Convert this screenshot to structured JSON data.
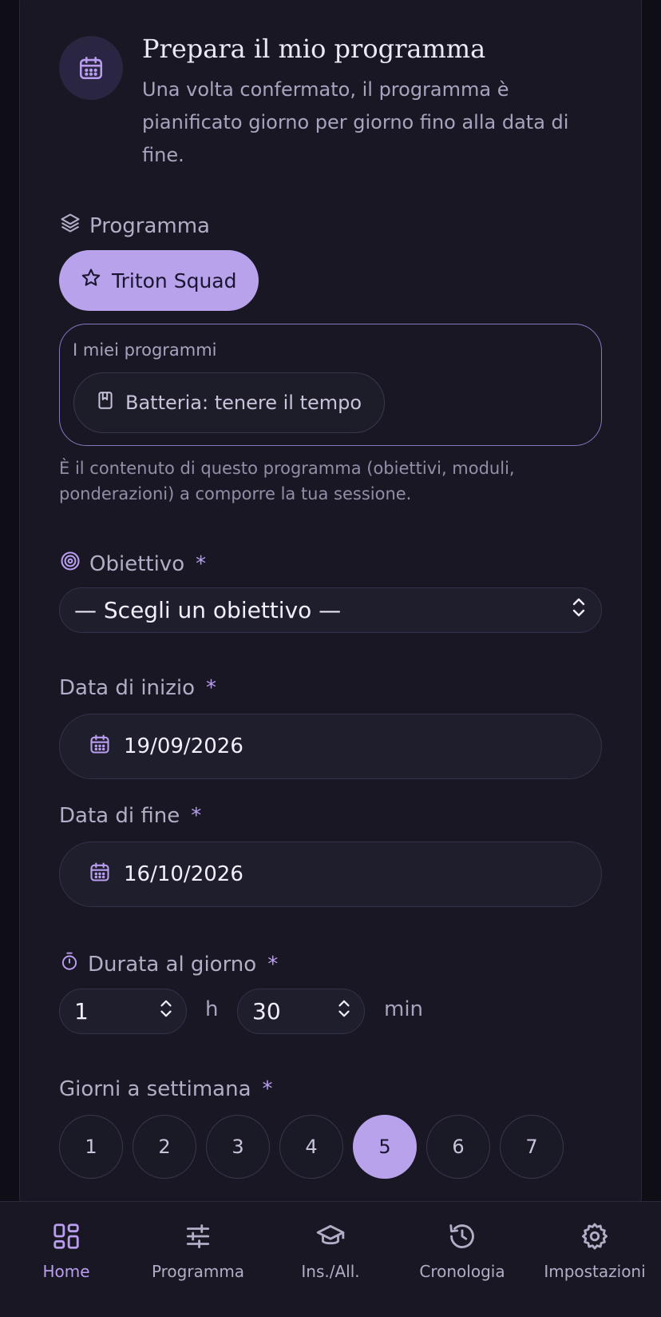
{
  "header": {
    "icon": "calendar-icon",
    "title": "Prepara il mio programma",
    "subtitle": "Una volta confermato, il programma è pianificato giorno per giorno fino alla data di fine."
  },
  "program": {
    "label": "Programma",
    "icon": "layers-icon",
    "active_chip": "Triton Squad",
    "my_programs_label": "I miei programmi",
    "my_program_chip": "Batteria: tenere il tempo",
    "help": "È il contenuto di questo programma (obiettivi, moduli, ponderazioni) a comporre la tua sessione."
  },
  "objective": {
    "label": "Obiettivo",
    "required_mark": "*",
    "placeholder": "— Scegli un obiettivo —"
  },
  "start_date": {
    "label": "Data di inizio",
    "required_mark": "*",
    "value": "19/09/2026"
  },
  "end_date": {
    "label": "Data di fine",
    "required_mark": "*",
    "value": "16/10/2026"
  },
  "duration": {
    "label": "Durata al giorno",
    "required_mark": "*",
    "hours": "1",
    "hours_unit": "h",
    "minutes": "30",
    "minutes_unit": "min"
  },
  "days_per_week": {
    "label": "Giorni a settimana",
    "required_mark": "*",
    "options": [
      "1",
      "2",
      "3",
      "4",
      "5",
      "6",
      "7"
    ],
    "selected": "5"
  },
  "nav": {
    "items": [
      {
        "label": "Home",
        "icon": "grid-icon",
        "active": true
      },
      {
        "label": "Programma",
        "icon": "sliders-icon",
        "active": false
      },
      {
        "label": "Ins./All.",
        "icon": "graduation-cap-icon",
        "active": false
      },
      {
        "label": "Cronologia",
        "icon": "history-icon",
        "active": false
      },
      {
        "label": "Impostazioni",
        "icon": "gear-icon",
        "active": false
      }
    ]
  },
  "colors": {
    "background": "#0f0e16",
    "card": "#181723",
    "accent": "#b8a2ec",
    "accent_text": "#b99ef0"
  }
}
